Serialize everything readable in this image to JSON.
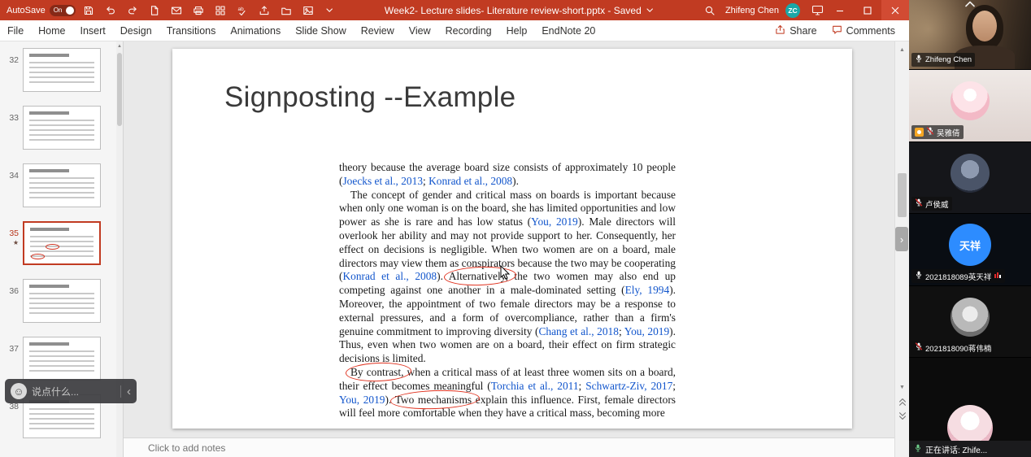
{
  "colors": {
    "titlebar_red": "#C13B22",
    "hyperlink_blue": "#1155CC",
    "annotation_red": "#E0321F",
    "zoom_avatar_blue": "#2D8CFF",
    "account_avatar_teal": "#1BA7A7"
  },
  "titlebar": {
    "autosave_label": "AutoSave",
    "autosave_state": "On",
    "doc_title": "Week2- Lecture slides- Literature review-short.pptx - Saved",
    "user_name": "Zhifeng Chen",
    "user_initials": "ZC"
  },
  "menubar": {
    "items": [
      "File",
      "Home",
      "Insert",
      "Design",
      "Transitions",
      "Animations",
      "Slide Show",
      "Review",
      "View",
      "Recording",
      "Help",
      "EndNote 20"
    ],
    "share_label": "Share",
    "comments_label": "Comments"
  },
  "thumbnail_panel": {
    "slides": [
      {
        "number": "32"
      },
      {
        "number": "33"
      },
      {
        "number": "34"
      },
      {
        "number": "35",
        "selected": true,
        "star": "★"
      },
      {
        "number": "36"
      },
      {
        "number": "37"
      },
      {
        "number": "38"
      }
    ]
  },
  "chat_overlay": {
    "emoji": "☺",
    "placeholder": "说点什么...",
    "collapse_glyph": "‹"
  },
  "slide": {
    "title": "Signposting --Example",
    "body": [
      {
        "segments": [
          {
            "t": "theory because the average board size consists of approximately 10 people ("
          },
          {
            "t": "Joecks et al., 2013",
            "s": "cite"
          },
          {
            "t": "; "
          },
          {
            "t": "Konrad et al., 2008",
            "s": "cite"
          },
          {
            "t": ")."
          }
        ]
      },
      {
        "segments": [
          {
            "t": "The concept of gender and critical mass on boards is important because when only one woman is on the board, she has limited opportunities and low power as she is rare and has low status ("
          },
          {
            "t": "You, 2019",
            "s": "cite"
          },
          {
            "t": "). Male directors will overlook her ability and may not provide support to her. Consequently, her effect on decisions is negligible. When two women are on a board, male directors may view them as conspirators because the two may be cooperating ("
          },
          {
            "t": "Konrad et al., 2008",
            "s": "cite"
          },
          {
            "t": "). "
          },
          {
            "t": "Alternatively,",
            "s": "circled"
          },
          {
            "t": " the two women may also end up competing against one another in a male-dominated setting ("
          },
          {
            "t": "Ely, 1994",
            "s": "cite"
          },
          {
            "t": "). Moreover, the appointment of two female directors may be a response to external pressures, and a form of overcompliance, rather than a firm's genuine commitment to improving diversity ("
          },
          {
            "t": "Chang et al., 2018",
            "s": "cite"
          },
          {
            "t": "; "
          },
          {
            "t": "You, 2019",
            "s": "cite"
          },
          {
            "t": "). Thus, even when two women are on a board, their effect on firm strategic decisions is limited."
          }
        ]
      },
      {
        "segments": [
          {
            "t": "By contrast,",
            "s": "circled"
          },
          {
            "t": " when a critical mass of at least three women sits on a board, their effect becomes meaningful ("
          },
          {
            "t": "Torchia et al., 2011",
            "s": "cite"
          },
          {
            "t": "; "
          },
          {
            "t": "Schwartz-Ziv, 2017",
            "s": "cite"
          },
          {
            "t": "; "
          },
          {
            "t": "You, 2019",
            "s": "cite"
          },
          {
            "t": "). "
          },
          {
            "t": "Two mechanisms",
            "s": "circled"
          },
          {
            "t": " explain this influence. First, female directors will feel more comfortable when they have a critical mass, becoming more"
          }
        ]
      }
    ]
  },
  "notes_bar": {
    "placeholder": "Click to add notes"
  },
  "video_panel": {
    "participants": [
      {
        "name": "Zhifeng Chen"
      },
      {
        "name": "吴雅倩"
      },
      {
        "name": "卢侯威"
      },
      {
        "name": "2021818089英天祥",
        "avatar_text": "天祥"
      },
      {
        "name": "2021818090蒋伟楠"
      },
      {
        "name": ""
      }
    ],
    "speaking_label": "正在讲话: Zhife..."
  }
}
